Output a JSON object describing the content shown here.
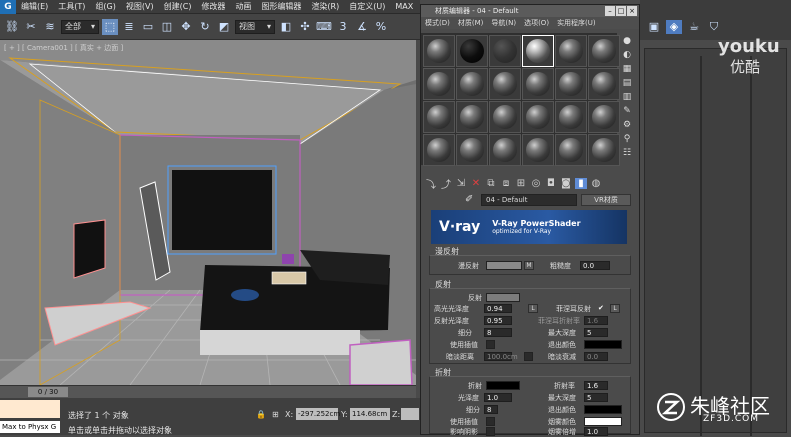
{
  "menubar": {
    "logo": "G",
    "items": [
      "编辑(E)",
      "工具(T)",
      "组(G)",
      "视图(V)",
      "创建(C)",
      "修改器",
      "动画",
      "图形编辑器",
      "渲染(R)",
      "自定义(U)",
      "MAX"
    ]
  },
  "toolbar": {
    "filter_value": "全部",
    "view_value": "视图",
    "snap_value": "3"
  },
  "viewport": {
    "label": "[ + ] [ Camera001 ] [ 真实 + 边面 ]"
  },
  "timebar": {
    "slider_label": "0 / 30"
  },
  "status": {
    "max_physx": "Max to Physx G",
    "selection_text": "选择了 1 个 对象",
    "prompt_text": "单击或单击并拖动以选择对象",
    "x_label": "X:",
    "x_value": "-297.252cm",
    "y_label": "Y:",
    "y_value": "114.68cm",
    "z_label": "Z:",
    "z_value": ""
  },
  "material_editor": {
    "title": "材质编辑器 - 04 - Default",
    "menu": [
      "模式(D)",
      "材质(M)",
      "导航(N)",
      "选项(O)",
      "实用程序(U)"
    ],
    "material_name": "04 - Default",
    "material_type": "VR材质",
    "banner": {
      "logo": "V·ray",
      "title": "V-Ray PowerShader",
      "subtitle": "optimized for V-Ray"
    },
    "diffuse": {
      "section": "漫反射",
      "diffuse_label": "漫反射",
      "diffuse_btn": "M",
      "roughness_label": "粗糙度",
      "roughness_value": "0.0"
    },
    "reflection": {
      "section": "反射",
      "reflect_label": "反射",
      "hilight_gloss_label": "高光光泽度",
      "hilight_gloss_value": "0.94",
      "lock_btn": "L",
      "fresnel_label": "菲涅耳反射",
      "fresnel_lock": "L",
      "refl_gloss_label": "反射光泽度",
      "refl_gloss_value": "0.95",
      "fresnel_ior_label": "菲涅耳折射率",
      "fresnel_ior_value": "1.6",
      "subdivs_label": "细分",
      "subdivs_value": "8",
      "max_depth_label": "最大深度",
      "max_depth_value": "5",
      "use_interp_label": "使用插值",
      "exit_color_label": "退出颜色",
      "dim_dist_label": "暗淡距离",
      "dim_dist_value": "100.0cm",
      "dim_falloff_label": "暗淡衰减",
      "dim_falloff_value": "0.0"
    },
    "refraction": {
      "section": "折射",
      "refract_label": "折射",
      "ior_label": "折射率",
      "ior_value": "1.6",
      "gloss_label": "光泽度",
      "gloss_value": "1.0",
      "max_depth_label": "最大深度",
      "max_depth_value": "5",
      "subdivs_label": "细分",
      "subdivs_value": "8",
      "exit_color_label": "退出颜色",
      "use_interp_label": "使用插值",
      "fog_color_label": "烟雾颜色",
      "affect_shadows_label": "影响阴影",
      "fog_mult_label": "烟雾倍增",
      "fog_mult_value": "1.0"
    }
  },
  "watermarks": {
    "youku_en": "youku",
    "youku_cn": "优酷",
    "zfsd_cn": "朱峰社区",
    "zfsd_en": "ZF3D.COM"
  },
  "colors": {
    "accent": "#4f7cc0",
    "vray_blue": "#1a3f78",
    "viewport_bg": "#6f6f6f"
  }
}
